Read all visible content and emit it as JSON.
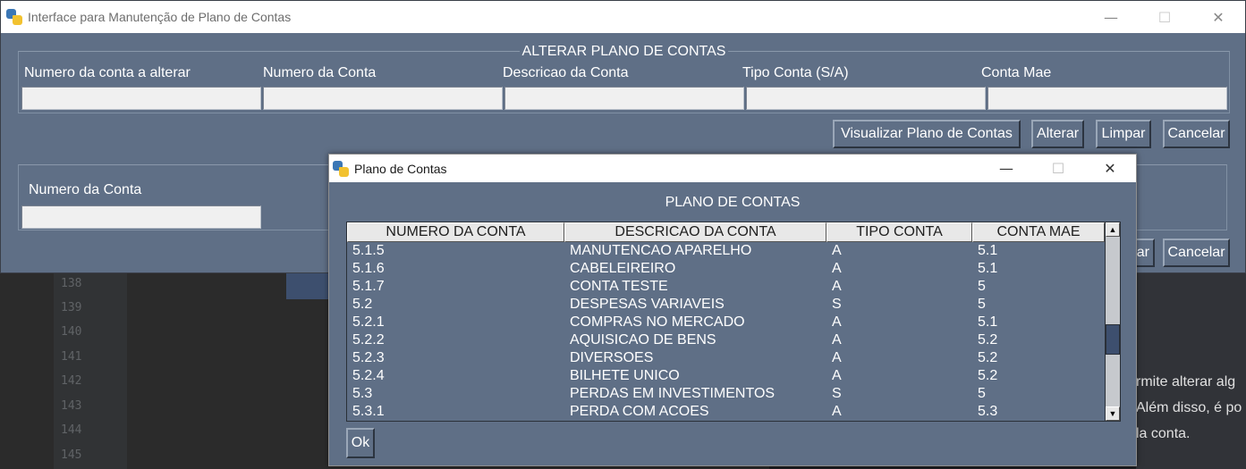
{
  "background": {
    "line_numbers": [
      "138",
      "139",
      "140",
      "141",
      "142",
      "143",
      "144",
      "145"
    ],
    "right_text": [
      "rmite alterar alg",
      "Além disso, é po",
      "la conta."
    ]
  },
  "main_window": {
    "title": "Interface para Manutenção de Plano de Contas",
    "controls": {
      "minimize": "—",
      "maximize": "☐",
      "close": "✕"
    },
    "group_title": "ALTERAR PLANO DE CONTAS",
    "fields": [
      {
        "label": "Numero da conta a alterar",
        "value": ""
      },
      {
        "label": "Numero da Conta",
        "value": ""
      },
      {
        "label": "Descricao da Conta",
        "value": ""
      },
      {
        "label": "Tipo Conta (S/A)",
        "value": ""
      },
      {
        "label": "Conta Mae",
        "value": ""
      }
    ],
    "buttons": {
      "visualizar": "Visualizar Plano de Contas",
      "alterar": "Alterar",
      "limpar": "Limpar",
      "cancelar": "Cancelar"
    },
    "lower_group": {
      "field_label": "Numero da Conta",
      "field_value": "",
      "partial_button": "ar",
      "cancelar": "Cancelar"
    }
  },
  "dialog": {
    "title": "Plano de Contas",
    "controls": {
      "minimize": "—",
      "maximize": "☐",
      "close": "✕"
    },
    "heading": "PLANO DE CONTAS",
    "columns": [
      "NUMERO DA CONTA",
      "DESCRICAO DA CONTA",
      "TIPO CONTA",
      "CONTA MAE"
    ],
    "rows": [
      [
        "5.1.5",
        "MANUTENCAO APARELHO",
        "A",
        "5.1"
      ],
      [
        "5.1.6",
        "CABELEIREIRO",
        "A",
        "5.1"
      ],
      [
        "5.1.7",
        "CONTA TESTE",
        "A",
        "5"
      ],
      [
        "5.2",
        "DESPESAS VARIAVEIS",
        "S",
        "5"
      ],
      [
        "5.2.1",
        "COMPRAS NO MERCADO",
        "A",
        "5.1"
      ],
      [
        "5.2.2",
        "AQUISICAO DE BENS",
        "A",
        "5.2"
      ],
      [
        "5.2.3",
        "DIVERSOES",
        "A",
        "5.2"
      ],
      [
        "5.2.4",
        "BILHETE UNICO",
        "A",
        "5.2"
      ],
      [
        "5.3",
        "PERDAS EM INVESTIMENTOS",
        "S",
        "5"
      ],
      [
        "5.3.1",
        "PERDA COM ACOES",
        "A",
        "5.3"
      ]
    ],
    "ok_label": "Ok"
  }
}
